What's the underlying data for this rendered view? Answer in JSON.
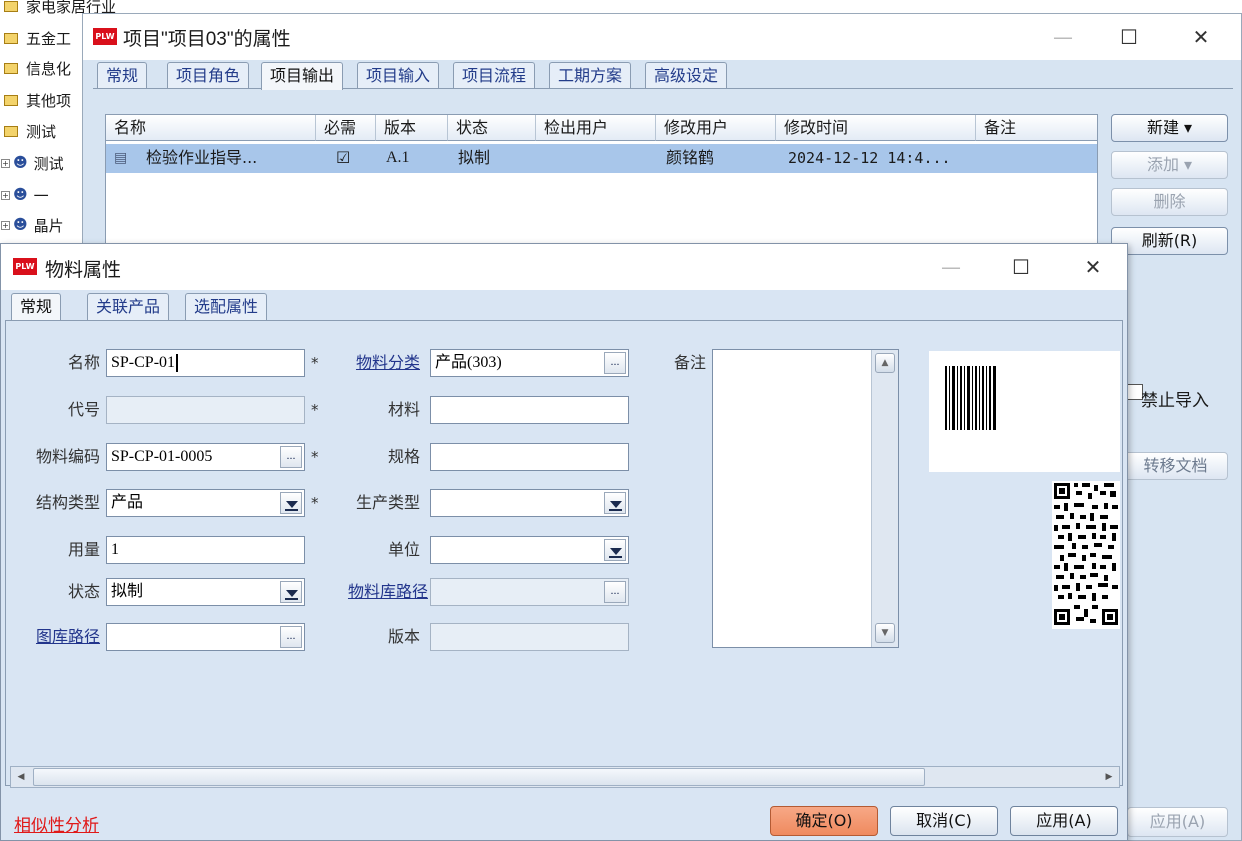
{
  "tree": {
    "items": [
      {
        "label": "家电家居行业",
        "type": "folder"
      },
      {
        "label": "五金工",
        "type": "folder"
      },
      {
        "label": "信息化",
        "type": "folder"
      },
      {
        "label": "其他项",
        "type": "folder"
      },
      {
        "label": "测试",
        "type": "folder"
      },
      {
        "label": "测试",
        "type": "person"
      },
      {
        "label": "一",
        "type": "person"
      },
      {
        "label": "晶片",
        "type": "person"
      }
    ]
  },
  "outer_dialog": {
    "title": "项目\"项目03\"的属性",
    "icon_text": "PLW",
    "tabs": [
      "常规",
      "项目角色",
      "项目输出",
      "项目输入",
      "项目流程",
      "工期方案",
      "高级设定"
    ],
    "active_tab": "项目输出",
    "table": {
      "columns": [
        "名称",
        "必需",
        "版本",
        "状态",
        "检出用户",
        "修改用户",
        "修改时间",
        "备注"
      ],
      "rows": [
        {
          "name": "检验作业指导...",
          "required": "☑",
          "version": "A.1",
          "status": "拟制",
          "checkout_user": "",
          "modify_user": "颜铭鹤",
          "modify_time": "2024-12-12 14:4...",
          "note": ""
        }
      ]
    },
    "buttons": {
      "new": "新建 ▾",
      "add": "添加 ▾",
      "delete": "删除",
      "refresh": "刷新(R)",
      "forbid_import": "禁止导入",
      "transfer_doc": "转移文档",
      "apply": "应用(A)"
    }
  },
  "inner_dialog": {
    "title": "物料属性",
    "icon_text": "PLW",
    "tabs": [
      "常规",
      "关联产品",
      "选配属性"
    ],
    "active_tab": "常规",
    "labels": {
      "name": "名称",
      "code": "代号",
      "material_code": "物料编码",
      "structure_type": "结构类型",
      "usage": "用量",
      "status": "状态",
      "drawing_path": "图库路径",
      "material_category": "物料分类",
      "material": "材料",
      "spec": "规格",
      "production_type": "生产类型",
      "unit": "单位",
      "material_lib_path": "物料库路径",
      "version": "版本",
      "notes": "备注"
    },
    "values": {
      "name": "SP-CP-01",
      "code": "",
      "material_code": "SP-CP-01-0005",
      "structure_type": "产品",
      "usage": "1",
      "status": "拟制",
      "drawing_path": "",
      "material_category": "产品(303)",
      "material": "",
      "spec": "",
      "production_type": "",
      "unit": "",
      "material_lib_path": "",
      "version": "",
      "notes": ""
    },
    "required_mark": "*",
    "ellipsis": "...",
    "footer": {
      "similarity_link": "相似性分析",
      "ok": "确定(O)",
      "cancel": "取消(C)",
      "apply": "应用(A)"
    }
  },
  "colors": {
    "dialog_bg": "#d9e5f3",
    "selected_row": "#a8c6ea",
    "link_red": "#e01818",
    "ok_button": "#ef8a5f",
    "plw_icon": "#d9101b"
  }
}
